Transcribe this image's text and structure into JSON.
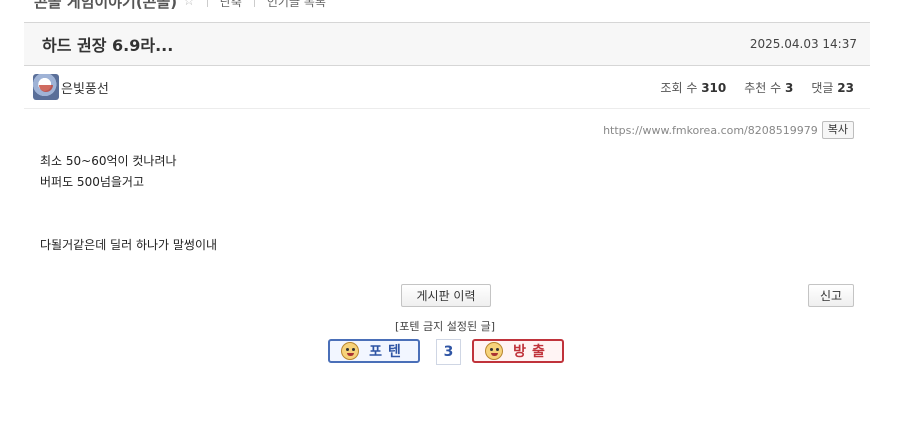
{
  "breadcrumb": {
    "board": "콘솔 게임이야기(콘솔)",
    "links": [
      "단축",
      "인기글 목록"
    ]
  },
  "post": {
    "title": "하드 권장 6.9라...",
    "date": "2025.04.03 14:37",
    "author": "은빛풍선",
    "views_label": "조회 수",
    "views": "310",
    "recommend_label": "추천 수",
    "recommend": "3",
    "comments_label": "댓글",
    "comments": "23",
    "url": "https://www.fmkorea.com/8208519979",
    "copy_label": "복사",
    "body_lines": [
      "최소 50~60억이 컷나려나",
      "버퍼도 500넘을거고",
      "",
      "",
      "다될거같은데 딜러 하나가 말썽이내"
    ]
  },
  "actions": {
    "history_label": "게시판 이력",
    "report_label": "신고",
    "notice": "[포텐 금지 설정된 글]",
    "vote_up_label": "포텐",
    "vote_count": "3",
    "vote_down_label": "방출"
  },
  "colors": {
    "vote_up": "#2f55a4",
    "vote_down": "#c0333b"
  }
}
